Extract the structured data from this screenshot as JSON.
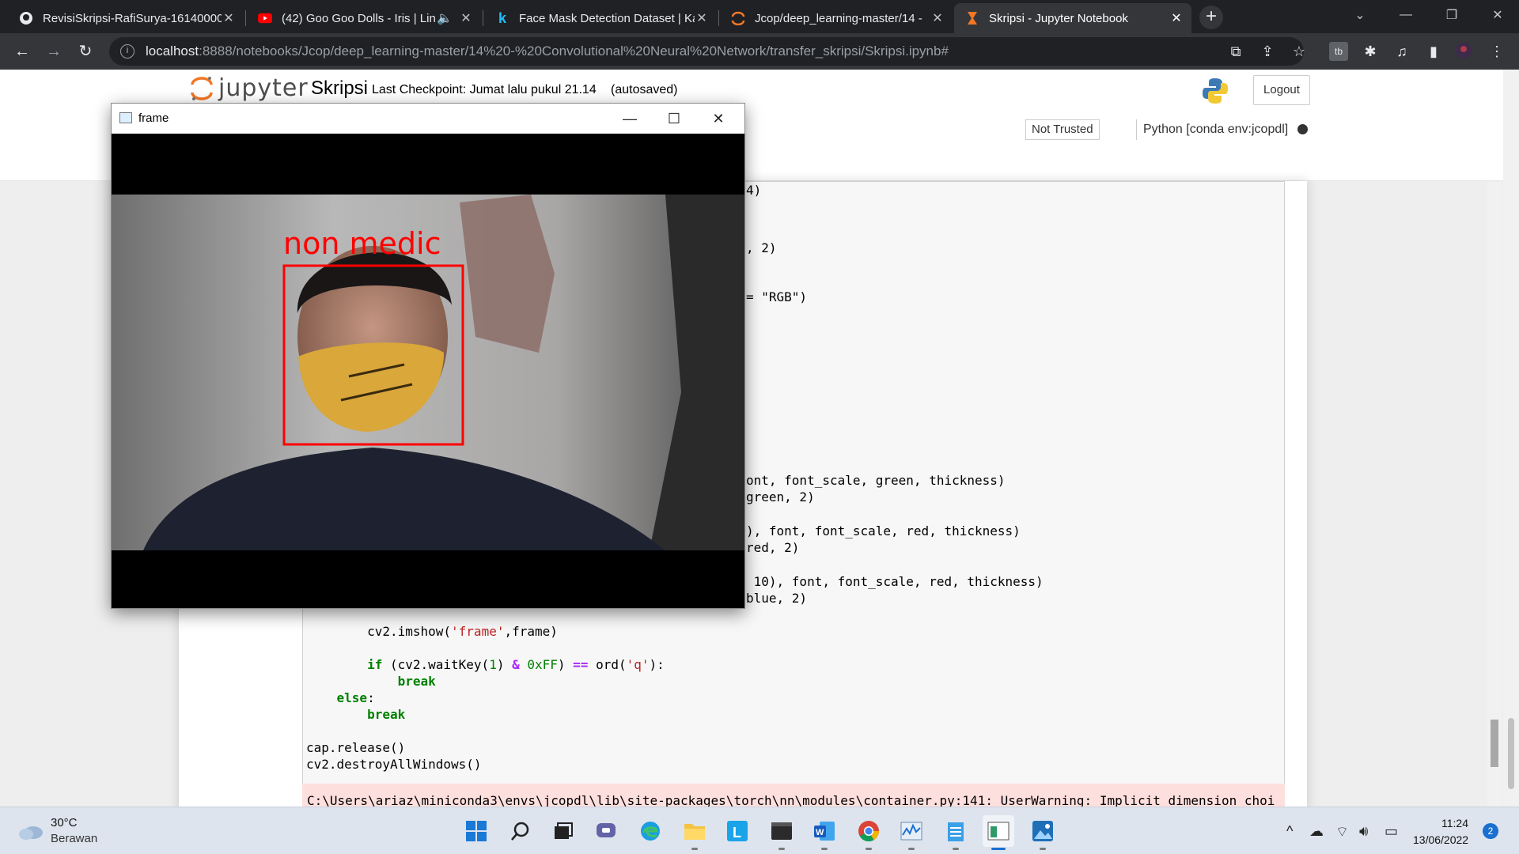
{
  "browser": {
    "tabs": [
      {
        "title": "RevisiSkripsi-RafiSurya-16140000",
        "icon": "github-icon"
      },
      {
        "title": "(42) Goo Goo Dolls - Iris | Lin",
        "icon": "youtube-icon"
      },
      {
        "title": "Face Mask Detection Dataset | Ka",
        "icon": "kaggle-icon"
      },
      {
        "title": "Jcop/deep_learning-master/14 - ",
        "icon": "jupyter-icon"
      },
      {
        "title": "Skripsi - Jupyter Notebook",
        "icon": "jupyter-hourglass-icon"
      }
    ],
    "url_host": "localhost",
    "url_path": ":8888/notebooks/Jcop/deep_learning-master/14%20-%20Convolutional%20Neural%20Network/transfer_skripsi/Skripsi.ipynb#"
  },
  "jupyter": {
    "brand": "jupyter",
    "notebook_name": "Skripsi",
    "checkpoint": "Last Checkpoint: Jumat lalu pukul 21.14",
    "autosaved": "(autosaved)",
    "logout": "Logout",
    "trust": "Not Trusted",
    "kernel": "Python [conda env:jcopdl]"
  },
  "code": {
    "frag1": "4)",
    "frag2": ", 2)",
    "frag3": "= \"RGB\")",
    "frag4": "ont, font_scale, green, thickness)",
    "frag5": "green, 2)",
    "frag6": "), font, font_scale, red, thickness)",
    "frag7": "red, 2)",
    "frag8": " 10), font, font_scale, red, thickness)",
    "frag9": "blue, 2)",
    "imshow_pre": "        cv2.imshow(",
    "imshow_str": "'frame'",
    "imshow_post": ",frame)",
    "if_kw": "if",
    "if_mid": " (cv2.waitKey(",
    "if_num1": "1",
    "if_mid2": ") ",
    "if_op": "&",
    "if_num2": " 0xFF",
    "if_mid3": ") ",
    "if_op2": "==",
    "if_mid4": " ord(",
    "if_str": "'q'",
    "if_end": "):",
    "break1": "break",
    "else_kw": "else",
    "else_colon": ":",
    "break2": "break",
    "release": "cap.release()",
    "destroy": "cv2.destroyAllWindows()",
    "warning": "C:\\Users\\ariaz\\miniconda3\\envs\\jcopdl\\lib\\site-packages\\torch\\nn\\modules\\container.py:141: UserWarning: Implicit dimension choi"
  },
  "cv_window": {
    "title": "frame",
    "label": "non medic",
    "label_color": "#ff0000"
  },
  "taskbar": {
    "temperature": "30°C",
    "weather": "Berawan",
    "time": "11:24",
    "date": "13/06/2022",
    "notifications": "2"
  }
}
